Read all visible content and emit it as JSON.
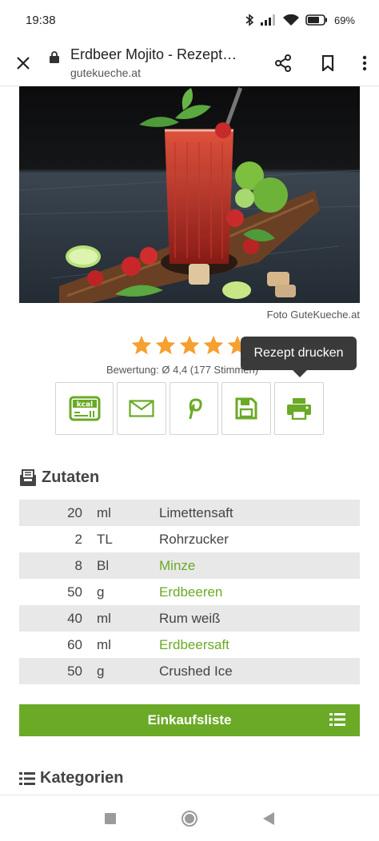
{
  "status_bar": {
    "time": "19:38",
    "battery": "69%"
  },
  "browser": {
    "title": "Erdbeer Mojito - Rezept | GuteKueche.at",
    "url": "gutekueche.at"
  },
  "hero": {
    "credit": "Foto GuteKueche.at"
  },
  "rating": {
    "value": 4.4,
    "max": 5,
    "text": "Bewertung: Ø 4,4 (177 Stimmen)"
  },
  "tooltip": {
    "label": "Rezept drucken"
  },
  "actions": [
    {
      "icon": "kcal-icon",
      "label": "kcal"
    },
    {
      "icon": "mail-icon"
    },
    {
      "icon": "pinterest-icon"
    },
    {
      "icon": "save-icon"
    },
    {
      "icon": "print-icon"
    }
  ],
  "ingredients": {
    "heading": "Zutaten",
    "items": [
      {
        "amount": "20",
        "unit": "ml",
        "name": "Limettensaft",
        "link": false
      },
      {
        "amount": "2",
        "unit": "TL",
        "name": "Rohrzucker",
        "link": false
      },
      {
        "amount": "8",
        "unit": "Bl",
        "name": "Minze",
        "link": true
      },
      {
        "amount": "50",
        "unit": "g",
        "name": "Erdbeeren",
        "link": true
      },
      {
        "amount": "40",
        "unit": "ml",
        "name": "Rum weiß",
        "link": false
      },
      {
        "amount": "60",
        "unit": "ml",
        "name": "Erdbeersaft",
        "link": true
      },
      {
        "amount": "50",
        "unit": "g",
        "name": "Crushed Ice",
        "link": false
      }
    ]
  },
  "shopping": {
    "label": "Einkaufsliste"
  },
  "categories": {
    "heading": "Kategorien"
  },
  "colors": {
    "accent": "#6aaa26",
    "star": "#f5a030",
    "tooltip": "#3a3a3a"
  }
}
